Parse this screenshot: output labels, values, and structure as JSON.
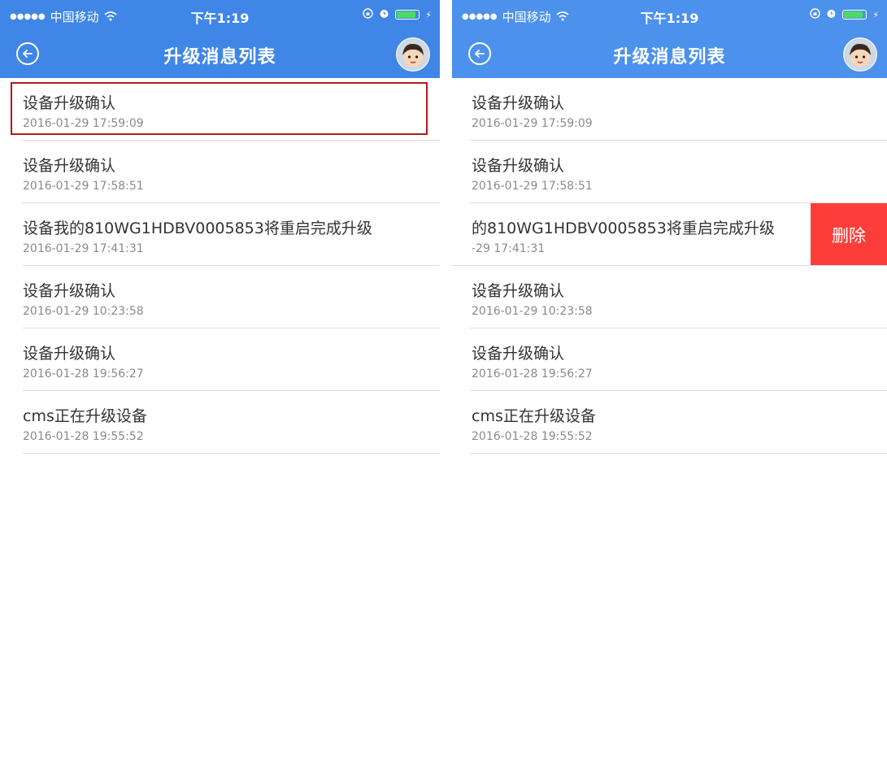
{
  "status_bar": {
    "carrier": "中国移动",
    "time": "下午1:19",
    "battery_level": 0.9
  },
  "nav": {
    "title": "升级消息列表"
  },
  "messages": [
    {
      "title": "设备升级确认",
      "time": "2016-01-29 17:59:09"
    },
    {
      "title": "设备升级确认",
      "time": "2016-01-29 17:58:51"
    },
    {
      "title": "设备我的810WG1HDBV0005853将重启完成升级",
      "time": "2016-01-29 17:41:31"
    },
    {
      "title": "设备升级确认",
      "time": "2016-01-29 10:23:58"
    },
    {
      "title": "设备升级确认",
      "time": "2016-01-28 19:56:27"
    },
    {
      "title": "cms正在升级设备",
      "time": "2016-01-28 19:55:52"
    }
  ],
  "swiped_row": {
    "title": "的810WG1HDBV0005853将重启完成升级",
    "time": "-29 17:41:31",
    "delete_label": "删除"
  },
  "colors": {
    "header": "#3f86e6",
    "delete": "#fc3d39",
    "highlight": "#b0191c"
  },
  "icons": [
    "signal-dots-icon",
    "wifi-icon",
    "lock-rotation-icon",
    "alarm-icon",
    "battery-icon",
    "charging-bolt-icon",
    "back-arrow-icon",
    "avatar-icon"
  ]
}
